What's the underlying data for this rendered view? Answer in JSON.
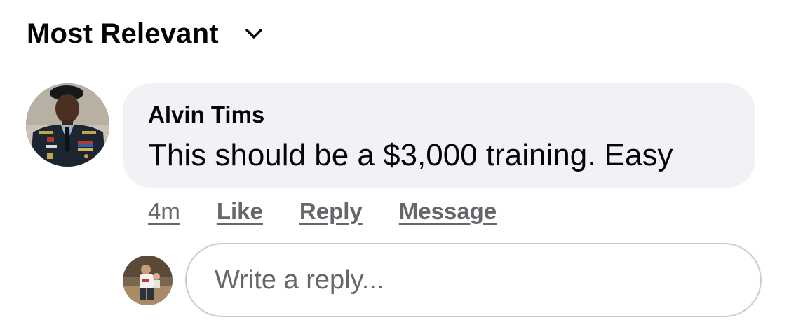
{
  "sort": {
    "label": "Most Relevant",
    "icon": "chevron-down-icon"
  },
  "comment": {
    "author": "Alvin Tims",
    "text": "This should be a $3,000 training. Easy",
    "time": "4m",
    "actions": {
      "like": "Like",
      "reply": "Reply",
      "message": "Message"
    }
  },
  "reply_box": {
    "placeholder": "Write a reply..."
  },
  "colors": {
    "bubble_bg": "#f0f2f5",
    "secondary_text": "#65676b",
    "primary_text": "#050505",
    "input_border": "#c9ccd1"
  }
}
